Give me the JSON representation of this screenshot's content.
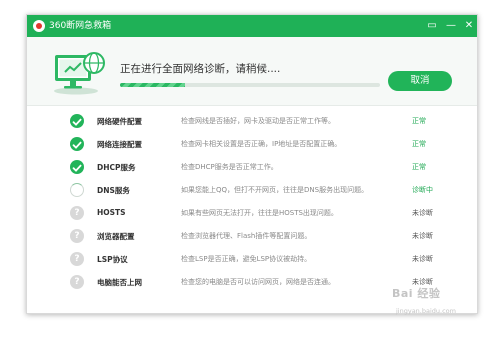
{
  "titlebar": {
    "title": "360断网急救箱",
    "feedback_glyph": "▭",
    "minimize_glyph": "—",
    "close_glyph": "✕"
  },
  "header": {
    "status_text": "正在进行全面网络诊断，请稍候....",
    "progress": 0.25,
    "cancel_label": "取消"
  },
  "items": [
    {
      "name": "网络硬件配置",
      "desc": "检查网线是否插好，网卡及驱动是否正常工作等。",
      "status": "正常",
      "state": "ok"
    },
    {
      "name": "网络连接配置",
      "desc": "检查网卡相关设置是否正确，IP地址是否配置正确。",
      "status": "正常",
      "state": "ok"
    },
    {
      "name": "DHCP服务",
      "desc": "检查DHCP服务是否正常工作。",
      "status": "正常",
      "state": "ok"
    },
    {
      "name": "DNS服务",
      "desc": "如果您能上QQ，但打不开网页，往往是DNS服务出现问题。",
      "status": "诊断中",
      "state": "checking"
    },
    {
      "name": "HOSTS",
      "desc": "如果有些网页无法打开，往往是HOSTS出现问题。",
      "status": "未诊断",
      "state": "pending"
    },
    {
      "name": "浏览器配置",
      "desc": "检查浏览器代理、Flash插件等配置问题。",
      "status": "未诊断",
      "state": "pending"
    },
    {
      "name": "LSP协议",
      "desc": "检查LSP是否正确，避免LSP协议被劫持。",
      "status": "未诊断",
      "state": "pending"
    },
    {
      "name": "电脑能否上网",
      "desc": "检查您的电脑是否可以访问网页，网络是否连通。",
      "status": "未诊断",
      "state": "pending"
    }
  ],
  "watermark": {
    "text": "Bai 经验",
    "sub": "jingyan.baidu.com"
  },
  "colors": {
    "brand_green": "#1fb157",
    "ok_green": "#22b45a",
    "pending_gray": "#d8d8d8"
  }
}
